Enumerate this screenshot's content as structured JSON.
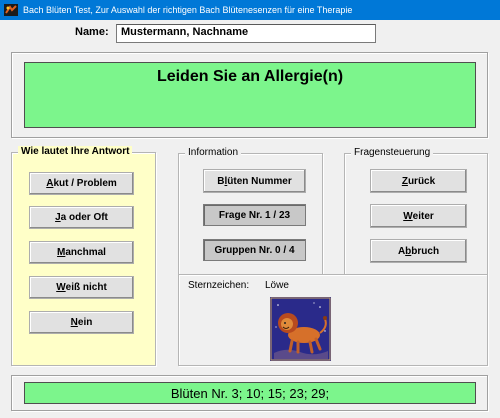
{
  "window": {
    "title": "Bach Blüten Test,    Zur Auswahl der richtigen Bach Blütenesenzen für eine Therapie"
  },
  "name_field": {
    "label": "Name:",
    "value": "Mustermann,  Nachname"
  },
  "question": {
    "text": "Leiden Sie an Allergie(n)"
  },
  "answers": {
    "legend": "Wie lautet Ihre Antwort",
    "buttons": [
      {
        "key": "A",
        "rest": "kut / Problem"
      },
      {
        "key": "J",
        "rest": "a oder Oft"
      },
      {
        "key": "M",
        "rest": "anchmal"
      },
      {
        "key": "W",
        "rest": "eiß nicht"
      },
      {
        "key": "N",
        "rest": "ein"
      }
    ]
  },
  "information": {
    "legend": "Information",
    "blueten_button": {
      "pre": "B",
      "key": "l",
      "rest": "üten Nummer"
    },
    "frage": "Frage Nr. 1 / 23",
    "gruppen": "Gruppen Nr. 0 / 4"
  },
  "navigation": {
    "legend": "Fragensteuerung",
    "back": {
      "pre": "",
      "key": "Z",
      "rest": "urück"
    },
    "next": {
      "pre": "",
      "key": "W",
      "rest": "eiter"
    },
    "cancel": {
      "pre": "A",
      "key": "b",
      "rest": "bruch"
    }
  },
  "zodiac": {
    "label": "Sternzeichen:",
    "value": "Löwe"
  },
  "result": {
    "text": "Blüten Nr.  3;  10;  15;  23;  29;"
  },
  "colors": {
    "titlebar": "#0078d7",
    "green_panel": "#7cf58c",
    "answer_panel": "#ffffc8",
    "window_bg": "#f0f0f0"
  }
}
